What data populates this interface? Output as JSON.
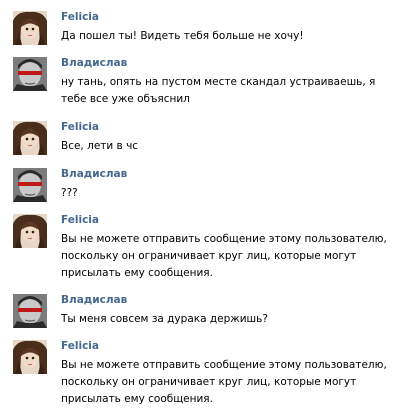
{
  "messages": [
    {
      "author": "Felicia",
      "avatar": "felicia-avatar",
      "text": "Да пошел ты! Видеть тебя больше не хочу!"
    },
    {
      "author": "Владислав",
      "avatar": "vladislav-avatar",
      "text": "ну тань, опять на пустом месте скандал устраиваешь, я тебе все уже объяснил"
    },
    {
      "author": "Felicia",
      "avatar": "felicia-avatar",
      "text": "Все, лети в чс"
    },
    {
      "author": "Владислав",
      "avatar": "vladislav-avatar",
      "text": "???"
    },
    {
      "author": "Felicia",
      "avatar": "felicia-avatar",
      "text": "Вы не можете отправить сообщение этому пользователю, поскольку он ограничивает круг лиц, которые могут присылать ему сообщения."
    },
    {
      "author": "Владислав",
      "avatar": "vladislav-avatar",
      "text": "Ты меня совсем за дурака держишь?"
    },
    {
      "author": "Felicia",
      "avatar": "felicia-avatar",
      "text": "Вы не можете отправить сообщение этому пользователю, поскольку он ограничивает круг лиц, которые могут присылать ему сообщения."
    }
  ],
  "colors": {
    "author": "#45688e",
    "text": "#000000",
    "background": "#ffffff"
  }
}
